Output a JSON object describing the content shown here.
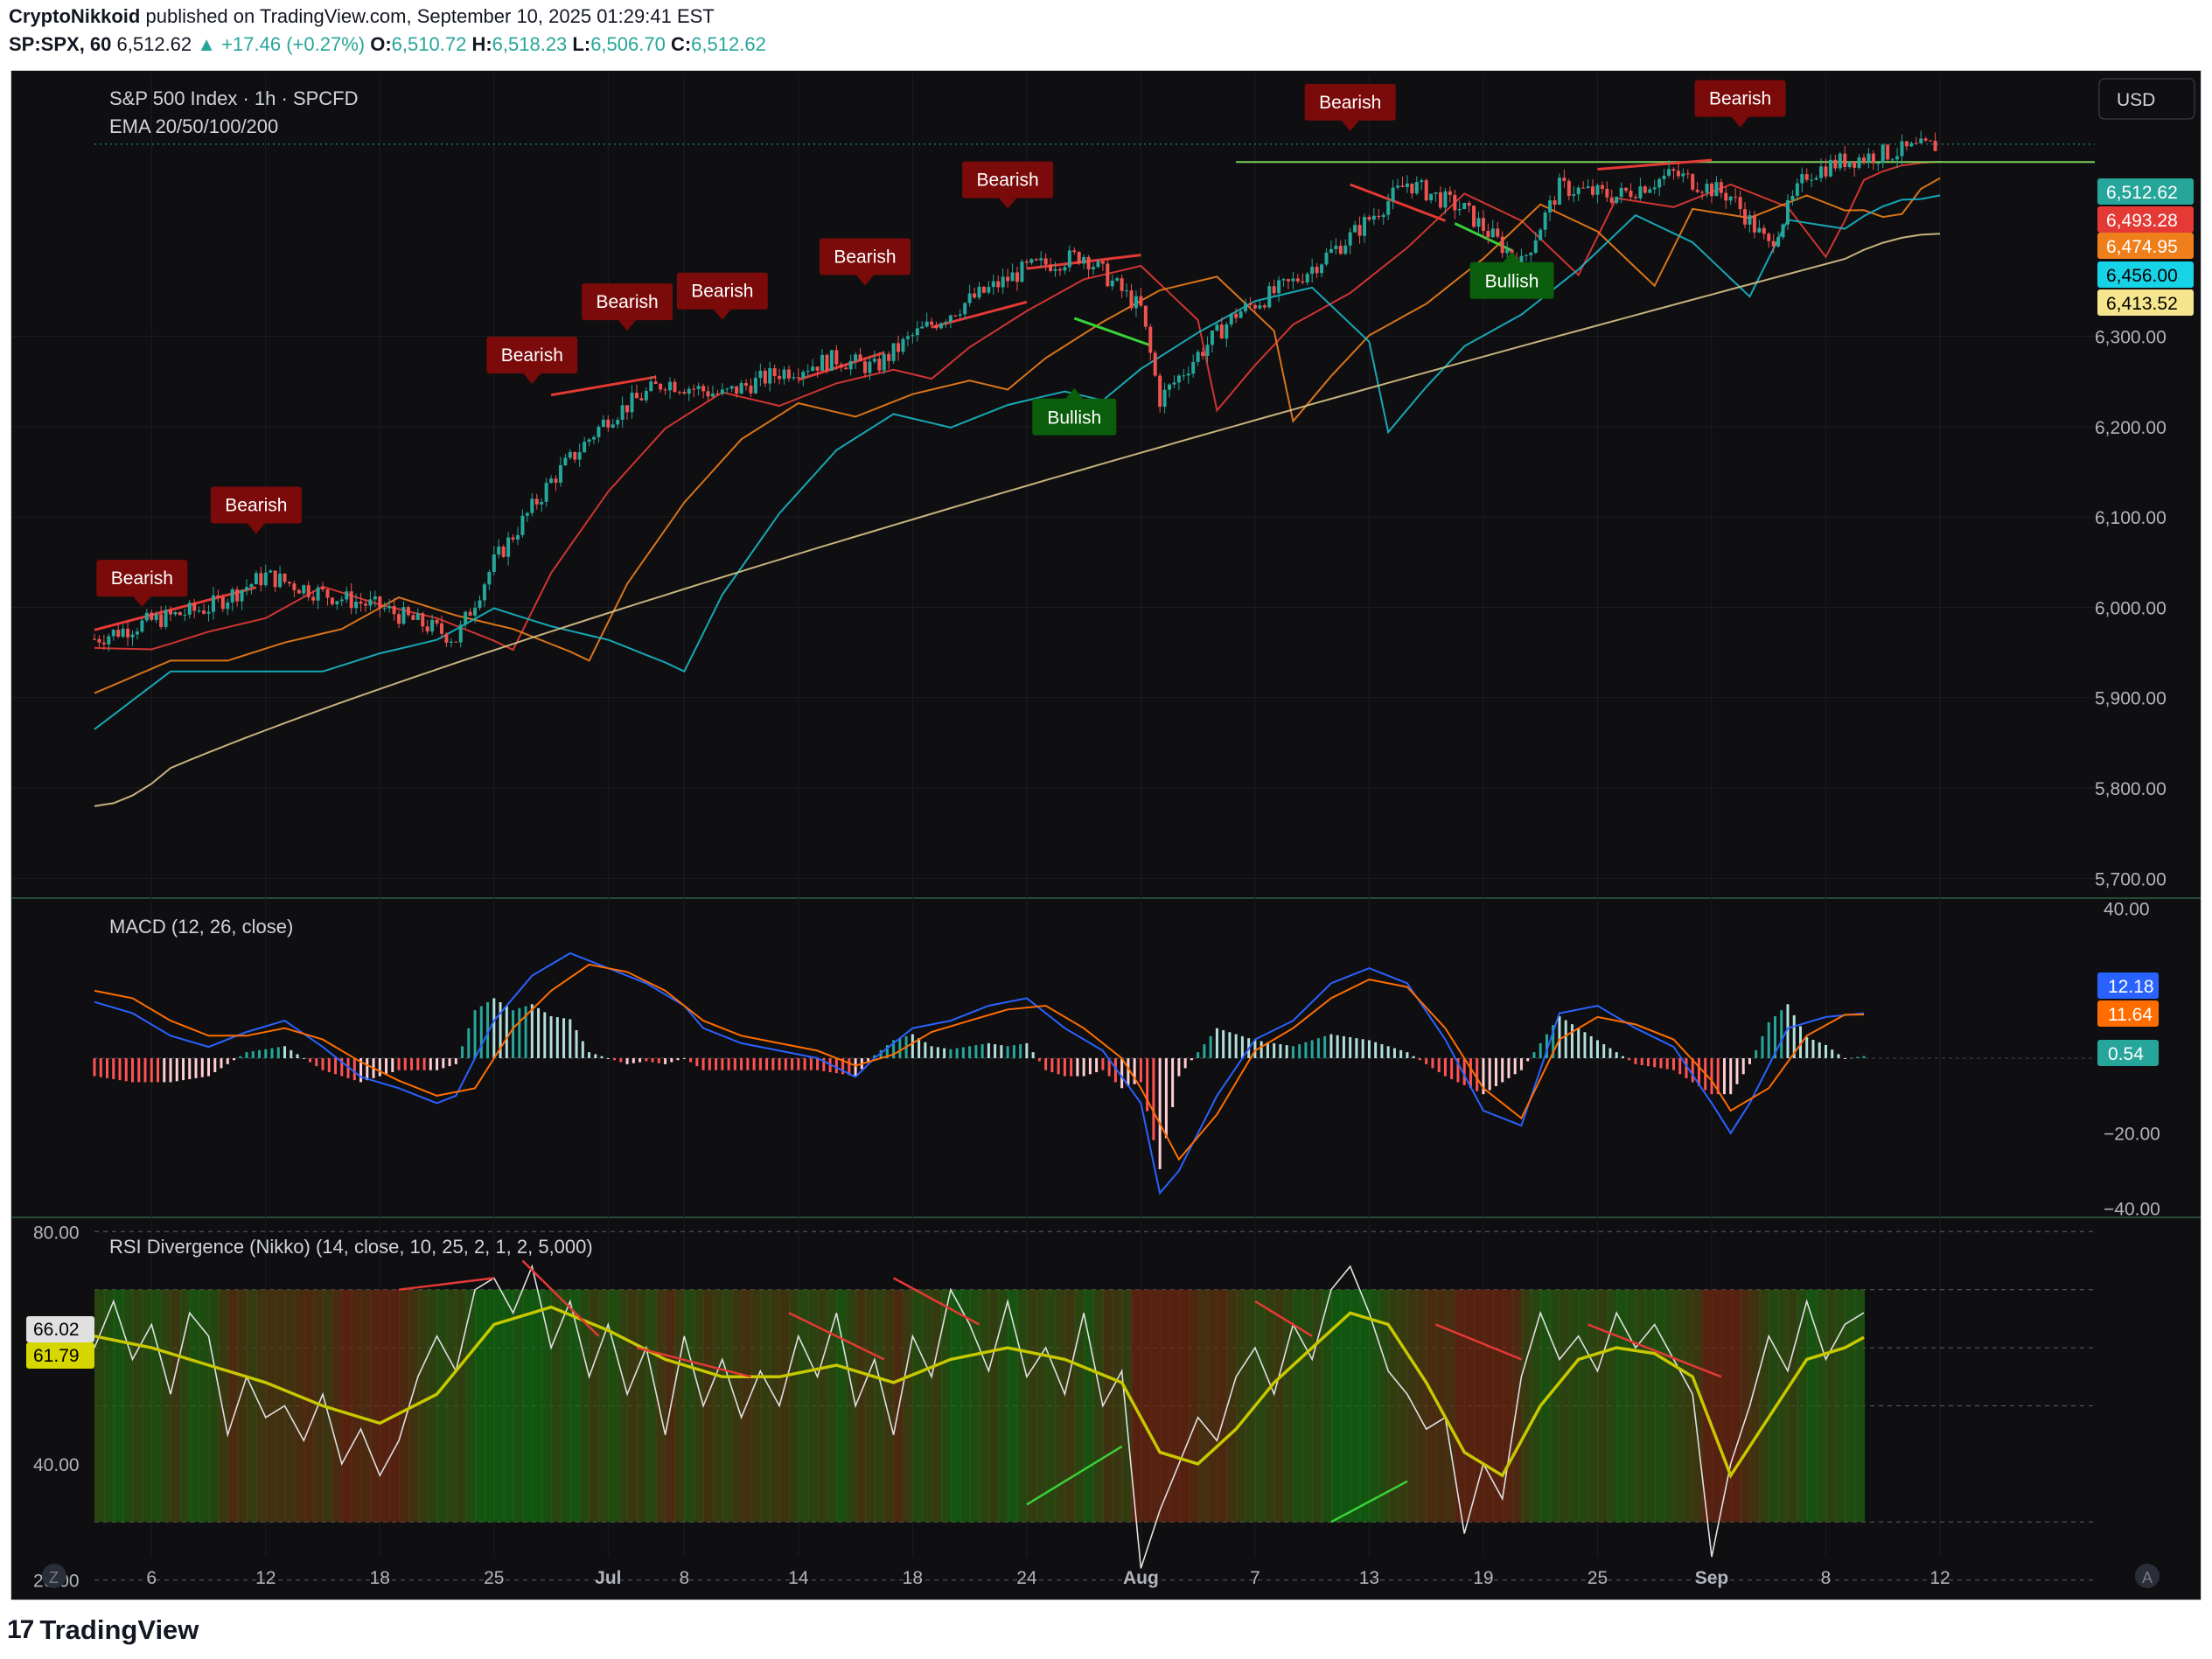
{
  "header": {
    "author": "CryptoNikkoid",
    "published": "published on TradingView.com, September 10, 2025 01:29:41 EST",
    "symbol": "SP:SPX, 60",
    "last": "6,512.62",
    "change": "+17.46 (+0.27%)",
    "o_label": "O:",
    "o": "6,510.72",
    "h_label": "H:",
    "h": "6,518.23",
    "l_label": "L:",
    "l": "6,506.70",
    "c_label": "C:",
    "c": "6,512.62"
  },
  "legend": {
    "title": "S&P 500 Index · 1h · SPCFD",
    "ema": "EMA 20/50/100/200",
    "macd": "MACD (12, 26, close)",
    "rsi": "RSI Divergence (Nikko) (14, close, 10, 25, 2, 1, 2, 5,000)"
  },
  "currency_button": "USD",
  "footer": {
    "brand": "TradingView",
    "z_button": "Z",
    "a_button": "A"
  },
  "colors": {
    "up": "#26a69a",
    "down": "#ef5350",
    "ema20": "#e53935",
    "ema50": "#ef7f1a",
    "ema100": "#17b8c9",
    "ema200": "#d9c489",
    "bearish": "#7b0a0a",
    "bullish": "#0b5e0b",
    "macd": "#2962ff",
    "signal": "#ff6d00",
    "rsi": "#e0e0e0",
    "rsi_ma": "#c8c800"
  },
  "chart_data": [
    {
      "type": "candlestick",
      "title": "S&P 500 Index · 1h · SPCFD",
      "ylim": [
        5680,
        6590
      ],
      "y_ticks": [
        "5,700.00",
        "5,800.00",
        "5,900.00",
        "6,000.00",
        "6,100.00",
        "6,200.00",
        "6,300.00"
      ],
      "x_labels": [
        "6",
        "12",
        "18",
        "25",
        "Jul",
        "8",
        "14",
        "18",
        "24",
        "Aug",
        "7",
        "13",
        "19",
        "25",
        "Sep",
        "8",
        "12"
      ],
      "x_label_positions": [
        3,
        9,
        15,
        21,
        27,
        31,
        37,
        43,
        49,
        55,
        61,
        67,
        73,
        79,
        85,
        91,
        97
      ],
      "close_approx": [
        [
          0,
          5965
        ],
        [
          3,
          5985
        ],
        [
          6,
          6000
        ],
        [
          9,
          6035
        ],
        [
          12,
          6015
        ],
        [
          15,
          6000
        ],
        [
          18,
          5975
        ],
        [
          19,
          5965
        ],
        [
          21,
          6050
        ],
        [
          24,
          6140
        ],
        [
          27,
          6210
        ],
        [
          30,
          6250
        ],
        [
          33,
          6235
        ],
        [
          36,
          6260
        ],
        [
          39,
          6275
        ],
        [
          41,
          6265
        ],
        [
          43,
          6300
        ],
        [
          46,
          6340
        ],
        [
          49,
          6375
        ],
        [
          52,
          6390
        ],
        [
          55,
          6330
        ],
        [
          56,
          6230
        ],
        [
          58,
          6280
        ],
        [
          60,
          6325
        ],
        [
          63,
          6360
        ],
        [
          66,
          6410
        ],
        [
          69,
          6470
        ],
        [
          72,
          6440
        ],
        [
          75,
          6380
        ],
        [
          77,
          6465
        ],
        [
          80,
          6455
        ],
        [
          83,
          6480
        ],
        [
          86,
          6455
        ],
        [
          88,
          6400
        ],
        [
          90,
          6480
        ],
        [
          92,
          6495
        ],
        [
          97,
          6512
        ]
      ],
      "series_ema_end": [
        {
          "name": "EMA 20",
          "value": 6493.28
        },
        {
          "name": "EMA 50",
          "value": 6474.95
        },
        {
          "name": "EMA 100",
          "value": 6456.0
        },
        {
          "name": "EMA 200",
          "value": 6413.52
        }
      ],
      "price_labels": [
        "6,512.62",
        "6,493.28",
        "6,474.95",
        "6,456.00",
        "6,413.52"
      ],
      "last_price": 6512.62,
      "resistance": 6493,
      "signals": [
        {
          "label": "Bearish",
          "x": 2.5,
          "y": 6008
        },
        {
          "label": "Bearish",
          "x": 8.5,
          "y": 6089
        },
        {
          "label": "Bearish",
          "x": 23,
          "y": 6255
        },
        {
          "label": "Bearish",
          "x": 28,
          "y": 6314
        },
        {
          "label": "Bearish",
          "x": 33,
          "y": 6326
        },
        {
          "label": "Bearish",
          "x": 40.5,
          "y": 6364
        },
        {
          "label": "Bearish",
          "x": 48,
          "y": 6449
        },
        {
          "label": "Bearish",
          "x": 66,
          "y": 6535
        },
        {
          "label": "Bearish",
          "x": 86.5,
          "y": 6539
        },
        {
          "label": "Bullish",
          "x": 51.5,
          "y": 6235
        },
        {
          "label": "Bullish",
          "x": 74.5,
          "y": 6386
        }
      ]
    },
    {
      "type": "line",
      "title": "MACD (12, 26, close)",
      "ylim": [
        -42,
        42
      ],
      "y_ticks": [
        "40.00",
        "−20.00",
        "−40.00"
      ],
      "macd": [
        [
          0,
          15
        ],
        [
          2,
          12
        ],
        [
          4,
          6
        ],
        [
          6,
          3
        ],
        [
          8,
          7
        ],
        [
          10,
          10
        ],
        [
          12,
          3
        ],
        [
          14,
          -5
        ],
        [
          16,
          -8
        ],
        [
          18,
          -12
        ],
        [
          19,
          -10
        ],
        [
          21,
          10
        ],
        [
          23,
          22
        ],
        [
          25,
          28
        ],
        [
          27,
          24
        ],
        [
          29,
          20
        ],
        [
          31,
          14
        ],
        [
          32,
          8
        ],
        [
          34,
          4
        ],
        [
          36,
          2
        ],
        [
          38,
          0
        ],
        [
          40,
          -5
        ],
        [
          41,
          0
        ],
        [
          43,
          8
        ],
        [
          45,
          10
        ],
        [
          47,
          14
        ],
        [
          49,
          16
        ],
        [
          51,
          8
        ],
        [
          53,
          2
        ],
        [
          55,
          -12
        ],
        [
          56,
          -36
        ],
        [
          57,
          -30
        ],
        [
          59,
          -10
        ],
        [
          61,
          5
        ],
        [
          63,
          10
        ],
        [
          65,
          20
        ],
        [
          67,
          24
        ],
        [
          69,
          20
        ],
        [
          71,
          5
        ],
        [
          73,
          -14
        ],
        [
          75,
          -18
        ],
        [
          77,
          12
        ],
        [
          79,
          14
        ],
        [
          81,
          8
        ],
        [
          83,
          3
        ],
        [
          85,
          -12
        ],
        [
          86,
          -20
        ],
        [
          87,
          -12
        ],
        [
          89,
          8
        ],
        [
          91,
          11
        ],
        [
          93,
          12
        ]
      ],
      "signal": [
        [
          0,
          18
        ],
        [
          2,
          16
        ],
        [
          4,
          10
        ],
        [
          6,
          6
        ],
        [
          8,
          6
        ],
        [
          10,
          8
        ],
        [
          12,
          5
        ],
        [
          14,
          -1
        ],
        [
          16,
          -6
        ],
        [
          18,
          -10
        ],
        [
          20,
          -8
        ],
        [
          22,
          8
        ],
        [
          24,
          18
        ],
        [
          26,
          25
        ],
        [
          28,
          23
        ],
        [
          30,
          18
        ],
        [
          32,
          10
        ],
        [
          34,
          6
        ],
        [
          36,
          4
        ],
        [
          38,
          2
        ],
        [
          40,
          -2
        ],
        [
          42,
          1
        ],
        [
          44,
          7
        ],
        [
          46,
          10
        ],
        [
          48,
          13
        ],
        [
          50,
          14
        ],
        [
          52,
          8
        ],
        [
          54,
          0
        ],
        [
          55,
          -8
        ],
        [
          57,
          -27
        ],
        [
          59,
          -15
        ],
        [
          61,
          2
        ],
        [
          63,
          8
        ],
        [
          65,
          16
        ],
        [
          67,
          21
        ],
        [
          69,
          19
        ],
        [
          71,
          8
        ],
        [
          73,
          -8
        ],
        [
          75,
          -16
        ],
        [
          77,
          5
        ],
        [
          79,
          11
        ],
        [
          81,
          9
        ],
        [
          83,
          5
        ],
        [
          85,
          -6
        ],
        [
          86,
          -14
        ],
        [
          88,
          -8
        ],
        [
          90,
          6
        ],
        [
          92,
          11.6
        ],
        [
          93,
          11.64
        ]
      ],
      "last": {
        "macd": 12.18,
        "signal": 11.64,
        "hist": 0.54
      },
      "price_labels": [
        "12.18",
        "11.64",
        "0.54"
      ]
    },
    {
      "type": "line",
      "title": "RSI Divergence (Nikko) (14, close, 10, 25, 2, 1, 2, 5,000)",
      "ylim": [
        18,
        82
      ],
      "y_ticks": [
        "80.00",
        "40.00",
        "20.00"
      ],
      "band": [
        30,
        70
      ],
      "rsi": [
        [
          0,
          60
        ],
        [
          1,
          68
        ],
        [
          2,
          58
        ],
        [
          3,
          64
        ],
        [
          4,
          52
        ],
        [
          5,
          66
        ],
        [
          6,
          62
        ],
        [
          7,
          45
        ],
        [
          8,
          55
        ],
        [
          9,
          48
        ],
        [
          10,
          50
        ],
        [
          11,
          44
        ],
        [
          12,
          52
        ],
        [
          13,
          40
        ],
        [
          14,
          46
        ],
        [
          15,
          38
        ],
        [
          16,
          44
        ],
        [
          17,
          55
        ],
        [
          18,
          62
        ],
        [
          19,
          56
        ],
        [
          20,
          70
        ],
        [
          21,
          72
        ],
        [
          22,
          66
        ],
        [
          23,
          74
        ],
        [
          24,
          60
        ],
        [
          25,
          68
        ],
        [
          26,
          55
        ],
        [
          27,
          64
        ],
        [
          28,
          52
        ],
        [
          29,
          60
        ],
        [
          30,
          45
        ],
        [
          31,
          62
        ],
        [
          32,
          50
        ],
        [
          33,
          58
        ],
        [
          34,
          48
        ],
        [
          35,
          56
        ],
        [
          36,
          50
        ],
        [
          37,
          62
        ],
        [
          38,
          55
        ],
        [
          39,
          66
        ],
        [
          40,
          50
        ],
        [
          41,
          58
        ],
        [
          42,
          45
        ],
        [
          43,
          62
        ],
        [
          44,
          55
        ],
        [
          45,
          70
        ],
        [
          46,
          64
        ],
        [
          47,
          56
        ],
        [
          48,
          68
        ],
        [
          49,
          55
        ],
        [
          50,
          60
        ],
        [
          51,
          52
        ],
        [
          52,
          66
        ],
        [
          53,
          50
        ],
        [
          54,
          56
        ],
        [
          55,
          22
        ],
        [
          56,
          32
        ],
        [
          57,
          40
        ],
        [
          58,
          48
        ],
        [
          59,
          44
        ],
        [
          60,
          55
        ],
        [
          61,
          60
        ],
        [
          62,
          52
        ],
        [
          63,
          64
        ],
        [
          64,
          58
        ],
        [
          65,
          70
        ],
        [
          66,
          74
        ],
        [
          67,
          66
        ],
        [
          68,
          56
        ],
        [
          69,
          52
        ],
        [
          70,
          46
        ],
        [
          71,
          48
        ],
        [
          72,
          28
        ],
        [
          73,
          40
        ],
        [
          74,
          34
        ],
        [
          75,
          55
        ],
        [
          76,
          66
        ],
        [
          77,
          58
        ],
        [
          78,
          62
        ],
        [
          79,
          56
        ],
        [
          80,
          66
        ],
        [
          81,
          60
        ],
        [
          82,
          64
        ],
        [
          83,
          58
        ],
        [
          84,
          52
        ],
        [
          85,
          24
        ],
        [
          86,
          40
        ],
        [
          87,
          50
        ],
        [
          88,
          62
        ],
        [
          89,
          56
        ],
        [
          90,
          68
        ],
        [
          91,
          58
        ],
        [
          92,
          64
        ],
        [
          93,
          66.02
        ]
      ],
      "rsi_ma": [
        [
          0,
          62
        ],
        [
          3,
          60
        ],
        [
          6,
          57
        ],
        [
          9,
          54
        ],
        [
          12,
          50
        ],
        [
          15,
          47
        ],
        [
          18,
          52
        ],
        [
          21,
          64
        ],
        [
          24,
          67
        ],
        [
          27,
          63
        ],
        [
          30,
          58
        ],
        [
          33,
          55
        ],
        [
          36,
          55
        ],
        [
          39,
          57
        ],
        [
          42,
          54
        ],
        [
          45,
          58
        ],
        [
          48,
          60
        ],
        [
          51,
          58
        ],
        [
          54,
          54
        ],
        [
          56,
          42
        ],
        [
          58,
          40
        ],
        [
          60,
          46
        ],
        [
          62,
          54
        ],
        [
          64,
          60
        ],
        [
          66,
          66
        ],
        [
          68,
          64
        ],
        [
          70,
          54
        ],
        [
          72,
          42
        ],
        [
          74,
          38
        ],
        [
          76,
          50
        ],
        [
          78,
          58
        ],
        [
          80,
          60
        ],
        [
          82,
          59
        ],
        [
          84,
          55
        ],
        [
          86,
          38
        ],
        [
          88,
          48
        ],
        [
          90,
          58
        ],
        [
          92,
          60
        ],
        [
          93,
          61.79
        ]
      ],
      "last": {
        "rsi": 66.02,
        "rsi_ma": 61.79
      },
      "price_labels": [
        "66.02",
        "61.79"
      ]
    }
  ]
}
